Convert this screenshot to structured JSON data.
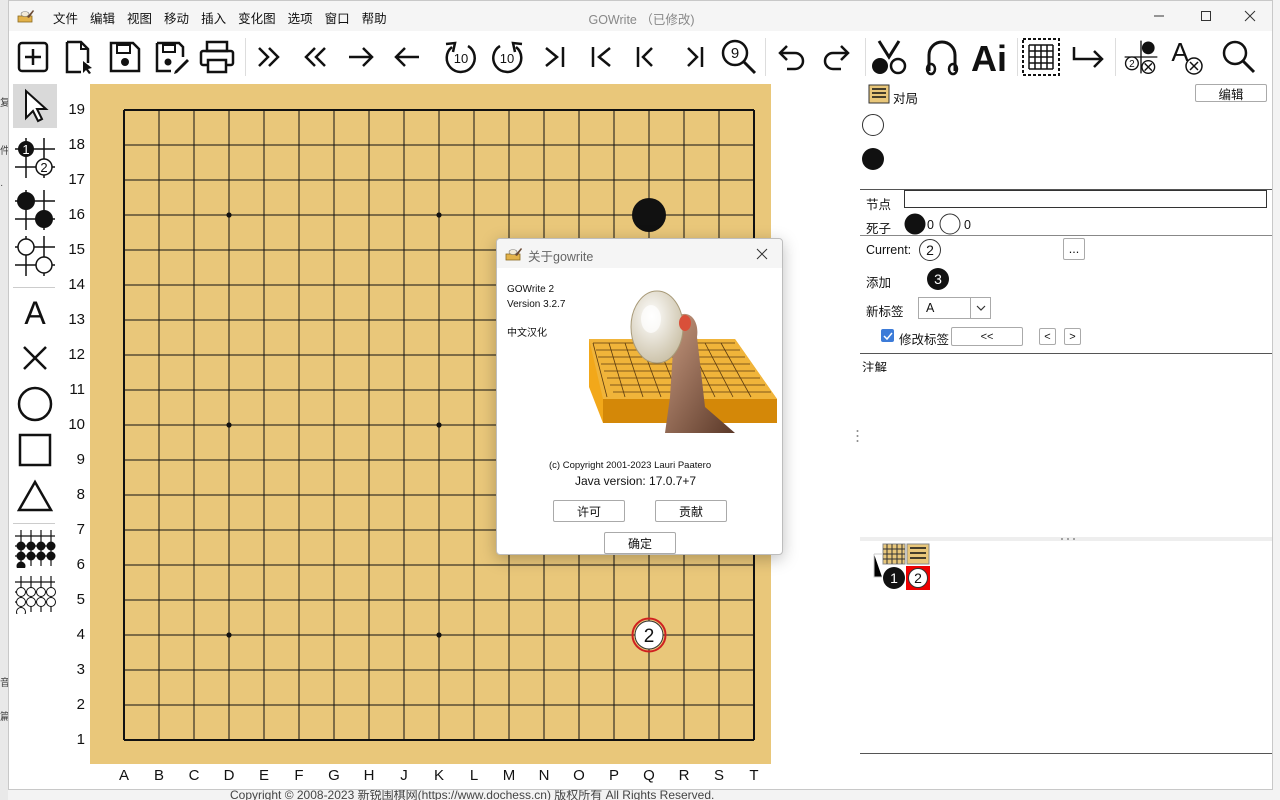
{
  "window": {
    "title": "GOWrite （已修改)",
    "menu": [
      "文件",
      "编辑",
      "视图",
      "移动",
      "插入",
      "变化图",
      "选项",
      "窗口",
      "帮助"
    ]
  },
  "toolbar": {
    "icons": [
      "new-icon",
      "open-icon",
      "save-icon",
      "save-as-icon",
      "print-icon",
      "fast-forward-icon",
      "fast-backward-icon",
      "forward-icon",
      "back-icon",
      "forward-10-icon",
      "back-10-icon",
      "last-move-icon",
      "first-move-icon",
      "previous-variation-icon",
      "next-variation-icon",
      "show-moves-icon",
      "undo-icon",
      "redo-icon",
      "cut-icon",
      "bend-icon",
      "label-ai-icon",
      "grid-icon",
      "return-icon",
      "remove-stone-icon",
      "remove-label-icon",
      "search-icon"
    ],
    "forward10": "10",
    "back10": "10",
    "magnify_number": "9",
    "label_ai": "Ai",
    "label_a": "A"
  },
  "left_tools": {
    "label_a": "A",
    "n1": "1",
    "n2": "2"
  },
  "board": {
    "rows": [
      "19",
      "18",
      "17",
      "16",
      "15",
      "14",
      "13",
      "12",
      "11",
      "10",
      "9",
      "8",
      "7",
      "6",
      "5",
      "4",
      "3",
      "2",
      "1"
    ],
    "cols": [
      "A",
      "B",
      "C",
      "D",
      "E",
      "F",
      "G",
      "H",
      "J",
      "K",
      "L",
      "M",
      "N",
      "O",
      "P",
      "Q",
      "R",
      "S",
      "T"
    ],
    "size": 19,
    "stones": [
      {
        "color": "black",
        "col": "Q",
        "row": "16",
        "number": ""
      },
      {
        "color": "white",
        "col": "Q",
        "row": "4",
        "number": "2",
        "last_move": true
      }
    ],
    "hoshi": [
      [
        "D",
        "16"
      ],
      [
        "K",
        "16"
      ],
      [
        "Q",
        "16"
      ],
      [
        "D",
        "10"
      ],
      [
        "K",
        "10"
      ],
      [
        "Q",
        "10"
      ],
      [
        "D",
        "4"
      ],
      [
        "K",
        "4"
      ],
      [
        "Q",
        "4"
      ]
    ]
  },
  "panel": {
    "game_label": "对局",
    "edit_button": "编辑",
    "node_label": "节点",
    "node_value": "",
    "captured_label": "死子",
    "captured_black": "0",
    "captured_white": "0",
    "current_label": "Current:",
    "current_number": "2",
    "more_button": "...",
    "add_label": "添加",
    "add_number": "3",
    "new_label_label": "新标签",
    "new_label_value": "A",
    "modify_label": "修改标签",
    "modify_checked": true,
    "prev_label_button": "<<",
    "lt_button": "<",
    "gt_button": ">",
    "comments_label": "注解",
    "tree_numbers": [
      "1",
      "2"
    ]
  },
  "dialog": {
    "title": "关于gowrite",
    "app_name": "GOWrite 2",
    "version": "Version 3.2.7",
    "localization": "中文汉化",
    "copyright": "(c) Copyright 2001-2023 Lauri Paatero",
    "java": "Java version: 17.0.7+7",
    "license_button": "许可",
    "contrib_button": "贡献",
    "ok_button": "确定"
  },
  "desktop": {
    "footer": "Copyright © 2008-2023 新锐围棋网(https://www.dochess.cn) 版权所有 All Rights Reserved.",
    "left_fragments": [
      "复",
      "件",
      "·",
      "音",
      "篇"
    ]
  }
}
